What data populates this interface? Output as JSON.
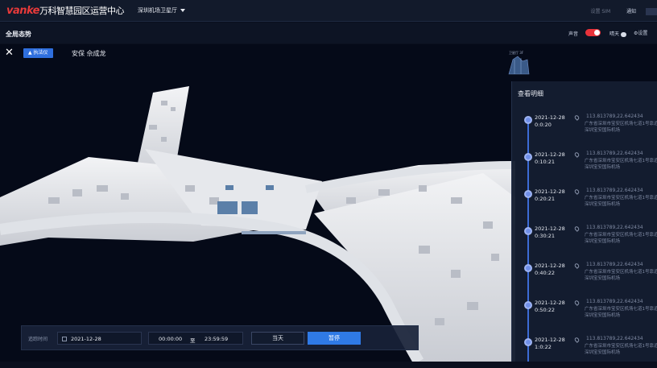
{
  "header": {
    "brand": "vanke",
    "app_title": "万科智慧园区运营中心",
    "site_selector": "深圳机场卫星厅",
    "right_items": [
      "设置 SIM",
      "通知"
    ]
  },
  "subbar": {
    "page_title": "全局态势",
    "sound_label": "声音",
    "weather_label": "晴天",
    "settings_label": "设置"
  },
  "overlay": {
    "close_icon": "close-icon",
    "role_tag": "执法仪",
    "person": "安保  佘成龙",
    "minimap_label": "卫星厅 3F"
  },
  "panel": {
    "title": "查看明细",
    "items": [
      {
        "time": "2021-12-28 0:0:20",
        "coord": "113.813789,22.642434",
        "addr": "广东省深圳市宝安区机场七道1号靠近深圳宝安国际机场"
      },
      {
        "time": "2021-12-28 0:10:21",
        "coord": "113.813789,22.642434",
        "addr": "广东省深圳市宝安区机场七道1号靠近深圳宝安国际机场"
      },
      {
        "time": "2021-12-28 0:20:21",
        "coord": "113.813789,22.642434",
        "addr": "广东省深圳市宝安区机场七道1号靠近深圳宝安国际机场"
      },
      {
        "time": "2021-12-28 0:30:21",
        "coord": "113.813789,22.642434",
        "addr": "广东省深圳市宝安区机场七道1号靠近深圳宝安国际机场"
      },
      {
        "time": "2021-12-28 0:40:22",
        "coord": "113.813789,22.642434",
        "addr": "广东省深圳市宝安区机场七道1号靠近深圳宝安国际机场"
      },
      {
        "time": "2021-12-28 0:50:22",
        "coord": "113.813789,22.642434",
        "addr": "广东省深圳市宝安区机场七道1号靠近深圳宝安国际机场"
      },
      {
        "time": "2021-12-28 1:0:22",
        "coord": "113.813789,22.642434",
        "addr": "广东省深圳市宝安区机场七道1号靠近深圳宝安国际机场"
      }
    ]
  },
  "controls": {
    "label": "追踪时间",
    "date": "2021-12-28",
    "time_from": "00:00:00",
    "time_sep": "至",
    "time_to": "23:59:59",
    "today_button": "当天",
    "pause_button": "暂停"
  },
  "colors": {
    "accent": "#2f7ae6",
    "brand_red": "#e83a3a",
    "toggle_on": "#e8323a"
  }
}
